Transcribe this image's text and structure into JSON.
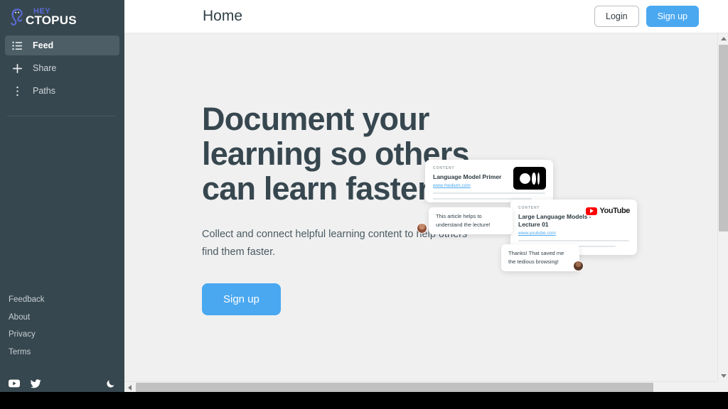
{
  "colors": {
    "sidebar_bg": "#37474f",
    "sidebar_active": "#4d5e67",
    "accent_blue": "#4aa8f0",
    "logo_hey": "#5b6bd6",
    "heading": "#37474f",
    "page_bg": "#f0f0f0"
  },
  "sidebar": {
    "logo": {
      "top": "HEY",
      "bottom": "CTOPUS",
      "icon": "octopus-logo-icon"
    },
    "nav": [
      {
        "label": "Feed",
        "icon": "list-icon",
        "active": true
      },
      {
        "label": "Share",
        "icon": "plus-icon",
        "active": false
      },
      {
        "label": "Paths",
        "icon": "vertical-dots-icon",
        "active": false
      }
    ],
    "footer_links": [
      {
        "label": "Feedback"
      },
      {
        "label": "About"
      },
      {
        "label": "Privacy"
      },
      {
        "label": "Terms"
      }
    ],
    "social": [
      {
        "name": "youtube-icon"
      },
      {
        "name": "twitter-icon"
      }
    ],
    "theme_toggle": {
      "name": "moon-icon"
    }
  },
  "header": {
    "title": "Home",
    "login_label": "Login",
    "signup_label": "Sign up"
  },
  "hero": {
    "title": "Document your learning so others can learn faster.",
    "subtitle": "Collect and connect helpful learning content to help others find them faster.",
    "cta_label": "Sign up"
  },
  "illustration": {
    "cards": [
      {
        "label": "CONTENT",
        "title": "Language Model Primer",
        "url": "www.medium.com",
        "brand": "medium-logo-icon"
      },
      {
        "label": "CONTENT",
        "title": "Large Language Models - Lecture 01",
        "url": "www.youtube.com",
        "brand": "youtube-logo-icon",
        "brand_text": "YouTube"
      }
    ],
    "comments": [
      {
        "text": "This article helps to understand the lecture!"
      },
      {
        "text": "Thanks! That saved me the tedious browsing!"
      }
    ]
  }
}
